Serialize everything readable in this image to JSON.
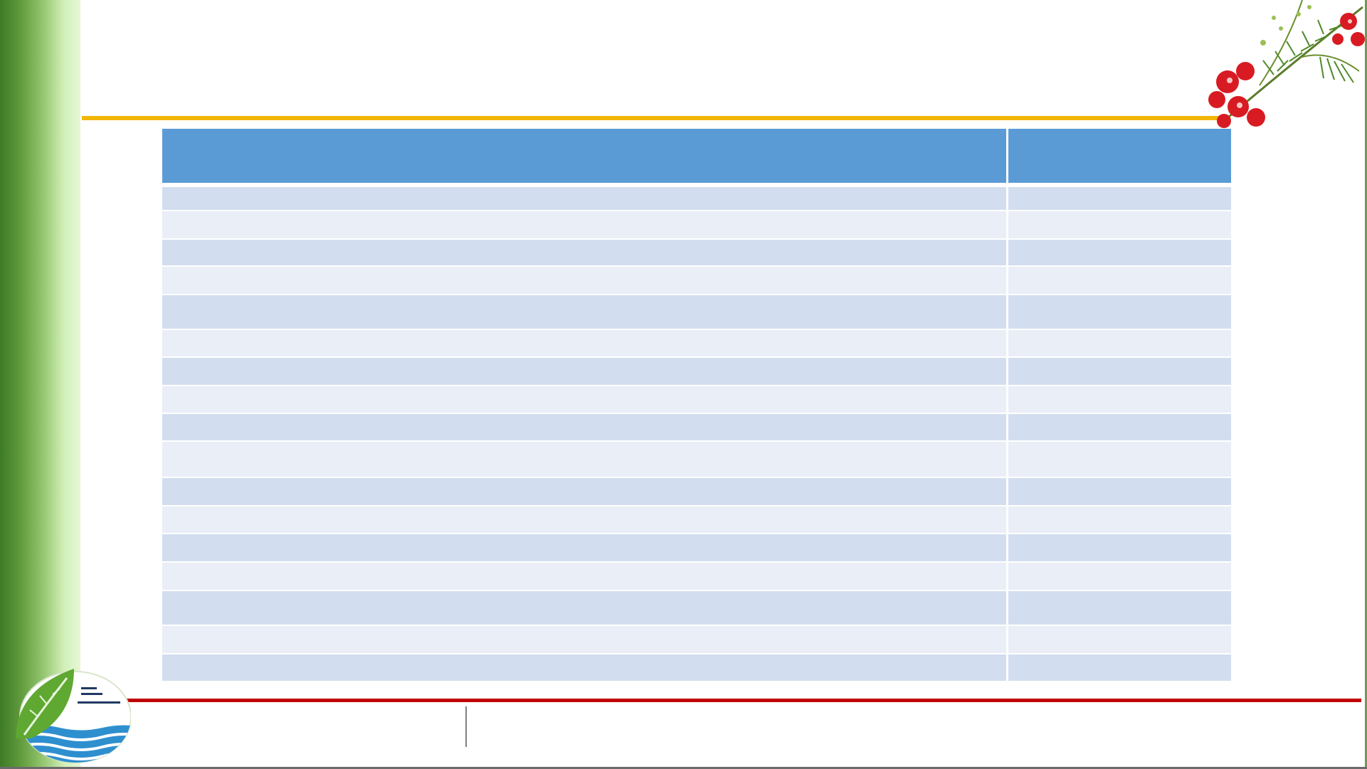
{
  "slide": {
    "title": ""
  },
  "table": {
    "headers": [
      "",
      ""
    ],
    "rows": [
      {
        "cells": [
          "",
          ""
        ],
        "height": 36
      },
      {
        "cells": [
          "",
          ""
        ],
        "height": 40
      },
      {
        "cells": [
          "",
          ""
        ],
        "height": 38
      },
      {
        "cells": [
          "",
          ""
        ],
        "height": 40
      },
      {
        "cells": [
          "",
          ""
        ],
        "height": 49
      },
      {
        "cells": [
          "",
          ""
        ],
        "height": 39
      },
      {
        "cells": [
          "",
          ""
        ],
        "height": 40
      },
      {
        "cells": [
          "",
          ""
        ],
        "height": 39
      },
      {
        "cells": [
          "",
          ""
        ],
        "height": 39
      },
      {
        "cells": [
          "",
          ""
        ],
        "height": 51
      },
      {
        "cells": [
          "",
          ""
        ],
        "height": 40
      },
      {
        "cells": [
          "",
          ""
        ],
        "height": 39
      },
      {
        "cells": [
          "",
          ""
        ],
        "height": 40
      },
      {
        "cells": [
          "",
          ""
        ],
        "height": 40
      },
      {
        "cells": [
          "",
          ""
        ],
        "height": 49
      },
      {
        "cells": [
          "",
          ""
        ],
        "height": 40
      },
      {
        "cells": [
          "",
          ""
        ],
        "height": 38
      }
    ]
  },
  "footer": {
    "left_text": "",
    "right_text": ""
  },
  "colors": {
    "header": "#5b9bd5",
    "row_odd": "#d2deef",
    "row_even": "#e9eef7",
    "gold_rule": "#f2b705",
    "red_rule": "#c00000"
  },
  "icons": {
    "flower": "flamboyant-flower-icon",
    "logo": "leaf-water-logo-icon"
  }
}
